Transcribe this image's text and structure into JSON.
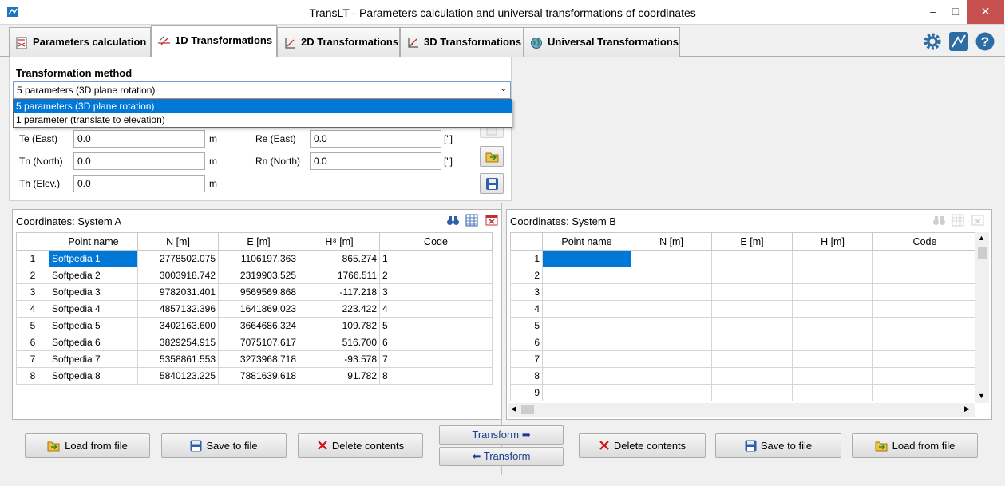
{
  "window": {
    "title": "TransLT - Parameters calculation and universal transformations of coordinates",
    "min": "–",
    "max": "□",
    "close": "✕"
  },
  "tabs": [
    {
      "label": "Parameters calculation",
      "icon": "calculator-icon"
    },
    {
      "label": "1D Transformations",
      "icon": "1d-axis-icon"
    },
    {
      "label": "2D Transformations",
      "icon": "2d-axis-icon"
    },
    {
      "label": "3D Transformations",
      "icon": "3d-axis-icon"
    },
    {
      "label": "Universal Transformations",
      "icon": "globe-icon"
    }
  ],
  "method": {
    "label": "Transformation method",
    "selected": "5 parameters (3D plane rotation)",
    "options": [
      "5 parameters (3D plane rotation)",
      "1 parameter (translate to elevation)"
    ]
  },
  "params": {
    "te": {
      "label": "Te (East)",
      "value": "0.0",
      "unit": "m"
    },
    "tn": {
      "label": "Tn (North)",
      "value": "0.0",
      "unit": "m"
    },
    "th": {
      "label": "Th (Elev.)",
      "value": "0.0",
      "unit": "m"
    },
    "re": {
      "label": "Re (East)",
      "value": "0.0",
      "unit": "[\"]"
    },
    "rn": {
      "label": "Rn (North)",
      "value": "0.0",
      "unit": "[\"]"
    }
  },
  "system_a": {
    "title": "Coordinates: System A",
    "headers": [
      "",
      "Point name",
      "N [m]",
      "E [m]",
      "H⁸ [m]",
      "Code"
    ],
    "rows": [
      [
        "1",
        "Softpedia 1",
        "2778502.075",
        "1106197.363",
        "865.274",
        "1"
      ],
      [
        "2",
        "Softpedia 2",
        "3003918.742",
        "2319903.525",
        "1766.511",
        "2"
      ],
      [
        "3",
        "Softpedia 3",
        "9782031.401",
        "9569569.868",
        "-117.218",
        "3"
      ],
      [
        "4",
        "Softpedia 4",
        "4857132.396",
        "1641869.023",
        "223.422",
        "4"
      ],
      [
        "5",
        "Softpedia 5",
        "3402163.600",
        "3664686.324",
        "109.782",
        "5"
      ],
      [
        "6",
        "Softpedia 6",
        "3829254.915",
        "7075107.617",
        "516.700",
        "6"
      ],
      [
        "7",
        "Softpedia 7",
        "5358861.553",
        "3273968.718",
        "-93.578",
        "7"
      ],
      [
        "8",
        "Softpedia 8",
        "5840123.225",
        "7881639.618",
        "91.782",
        "8"
      ]
    ]
  },
  "system_b": {
    "title": "Coordinates: System B",
    "headers": [
      "",
      "Point name",
      "N [m]",
      "E [m]",
      "H [m]",
      "Code"
    ],
    "row_numbers": [
      "1",
      "2",
      "3",
      "4",
      "5",
      "6",
      "7",
      "8",
      "9"
    ]
  },
  "buttons": {
    "load_a": "Load from file",
    "save_a": "Save to file",
    "delete_a": "Delete contents",
    "transform_fwd": "Transform ➡",
    "transform_back": "⬅ Transform",
    "delete_b": "Delete contents",
    "save_b": "Save to file",
    "load_b": "Load from file"
  }
}
